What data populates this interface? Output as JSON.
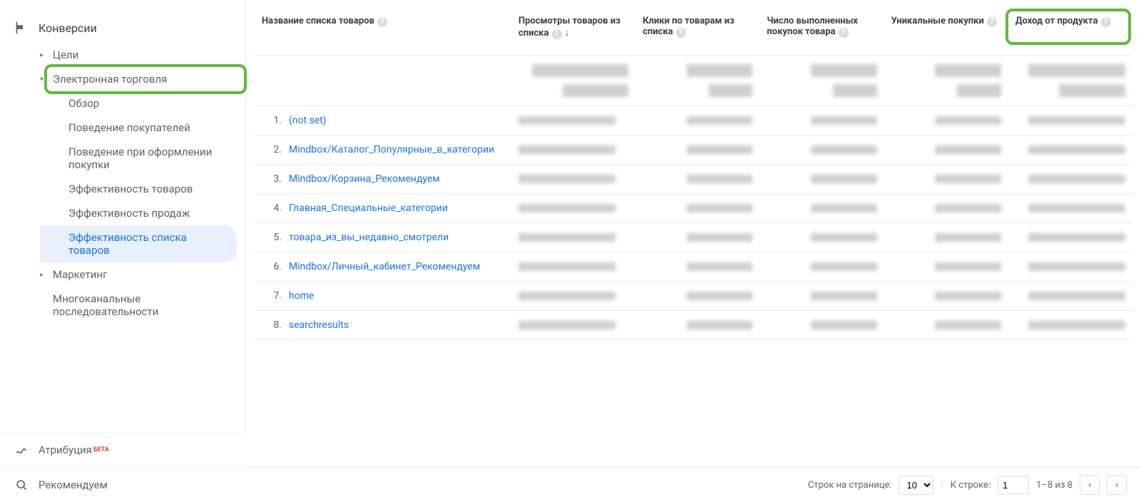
{
  "sidebar": {
    "section": "Конверсии",
    "items": [
      {
        "label": "Цели",
        "caret": "▸",
        "level": 1
      },
      {
        "label": "Электронная торговля",
        "caret": "▾",
        "level": 1,
        "highlight": true
      },
      {
        "label": "Обзор",
        "level": 2
      },
      {
        "label": "Поведение покупателей",
        "level": 2
      },
      {
        "label": "Поведение при оформлении покупки",
        "level": 2
      },
      {
        "label": "Эффективность товаров",
        "level": 2
      },
      {
        "label": "Эффективность продаж",
        "level": 2
      },
      {
        "label": "Эффективность списка товаров",
        "level": 2,
        "active": true
      },
      {
        "label": "Маркетинг",
        "caret": "▸",
        "level": 1
      },
      {
        "label": "Многоканальные последовательности",
        "level": 1
      }
    ],
    "bottom": [
      {
        "label": "Атрибуция",
        "beta": "БЕТА",
        "icon": "attribution"
      },
      {
        "label": "Рекомендуем",
        "icon": "discover"
      }
    ]
  },
  "table": {
    "headers": [
      {
        "label": "Название списка товаров",
        "help": true,
        "klass": "col-name"
      },
      {
        "label": "Просмотры товаров из списка",
        "help": true,
        "sort": "↓"
      },
      {
        "label": "Клики по товарам из списка",
        "help": true
      },
      {
        "label": "Число выполненных покупок товара",
        "help": true
      },
      {
        "label": "Уникальные покупки",
        "help": true
      },
      {
        "label": "Доход от продукта",
        "help": true,
        "highlight": true
      }
    ],
    "rows": [
      {
        "idx": "1.",
        "name": "(not set)"
      },
      {
        "idx": "2.",
        "name": "Mindbox/Каталог_Популярные_в_категории"
      },
      {
        "idx": "3.",
        "name": "Mindbox/Корзина_Рекомендуем"
      },
      {
        "idx": "4.",
        "name": "Главная_Специальные_категории"
      },
      {
        "idx": "5.",
        "name": "товара_из_вы_недавно_смотрели"
      },
      {
        "idx": "6.",
        "name": "Mindbox/Личный_кабинет_Рекомендуем"
      },
      {
        "idx": "7.",
        "name": "home"
      },
      {
        "idx": "8.",
        "name": "searchresults"
      }
    ]
  },
  "pager": {
    "rows_label": "Строк на странице:",
    "rows_value": "10",
    "goto_label": "К строке:",
    "goto_value": "1",
    "range": "1–8 из 8"
  }
}
